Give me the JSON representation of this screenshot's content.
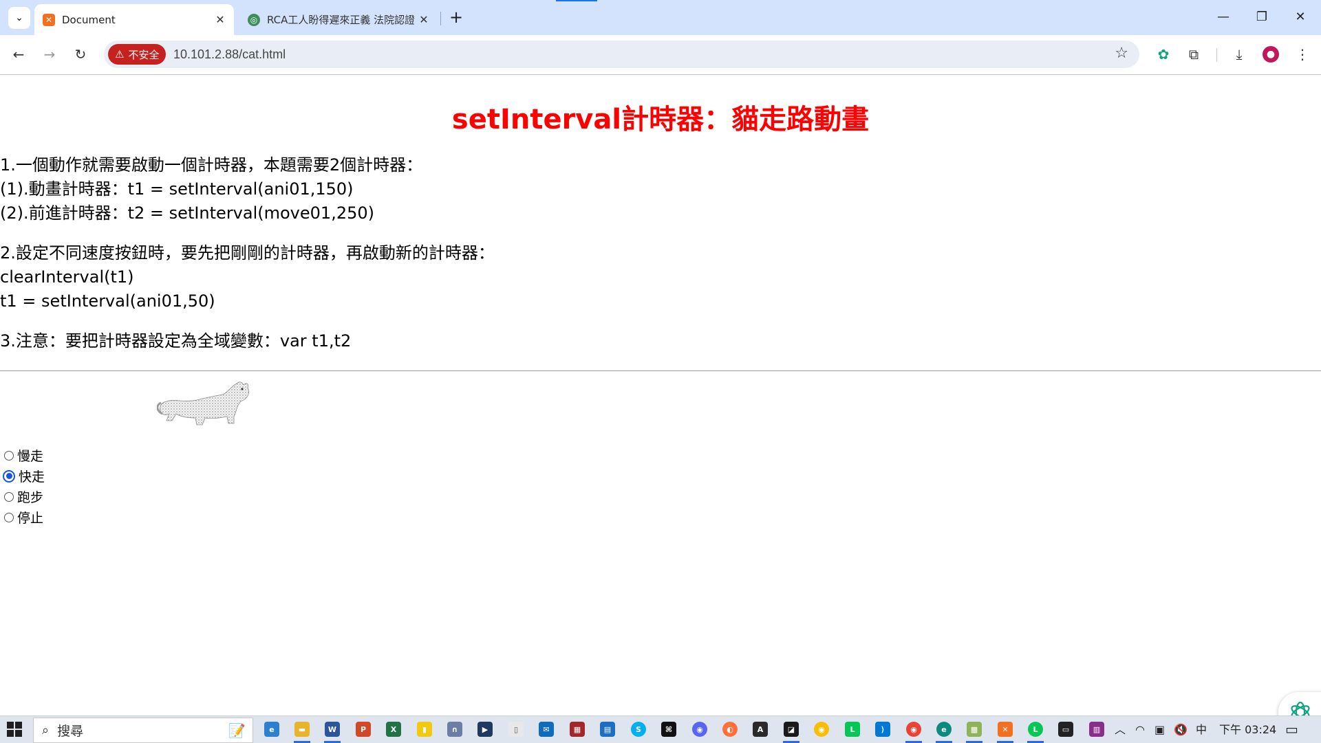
{
  "browser": {
    "tabs": [
      {
        "title": "Document",
        "active": true,
        "favicon": "xampp-icon",
        "favicon_color": "#f37021"
      },
      {
        "title": "RCA工人盼得遲來正義 法院認證",
        "active": false,
        "favicon": "globe-icon",
        "favicon_color": "#3c8f5a"
      }
    ],
    "address": {
      "security_label": "不安全",
      "url": "10.101.2.88/cat.html"
    }
  },
  "page": {
    "title": "setInterval計時器：貓走路動畫",
    "paragraphs": [
      [
        "1.一個動作就需要啟動一個計時器，本題需要2個計時器：",
        "(1).動畫計時器：t1 = setInterval(ani01,150)",
        "(2).前進計時器：t2 = setInterval(move01,250)"
      ],
      [
        "2.設定不同速度按鈕時，要先把剛剛的計時器，再啟動新的計時器：",
        "clearInterval(t1)",
        "t1 = setInterval(ani01,50)"
      ],
      [
        "3.注意：要把計時器設定為全域變數：var t1,t2"
      ]
    ],
    "radios": [
      {
        "label": "慢走",
        "checked": false
      },
      {
        "label": "快走",
        "checked": true
      },
      {
        "label": "跑步",
        "checked": false
      },
      {
        "label": "停止",
        "checked": false
      }
    ]
  },
  "taskbar": {
    "search_placeholder": "搜尋",
    "ime": "中",
    "clock": "下午 03:24",
    "apps": [
      "edge-icon",
      "file-explorer-icon",
      "word-icon",
      "powerpoint-icon",
      "excel-icon",
      "file-icon",
      "headset-icon",
      "zoom-icon",
      "notepad-icon",
      "mail-icon",
      "film-icon",
      "calendar-icon",
      "skype-icon",
      "capcut-icon",
      "discord-icon",
      "firefox-icon",
      "acrobat-icon",
      "sticky-notes-icon",
      "chrome-icon",
      "line-icon",
      "vscode-icon",
      "chrome-profile-icon",
      "edge-dev-icon",
      "minecraft-icon",
      "xampp-icon",
      "line2-icon",
      "terminal-icon",
      "winrar-icon"
    ]
  },
  "colors": {
    "title": "#ff0000",
    "tabstrip": "#d3e3fd",
    "insecure": "#c5221f",
    "radio_checked": "#1a57d8"
  }
}
